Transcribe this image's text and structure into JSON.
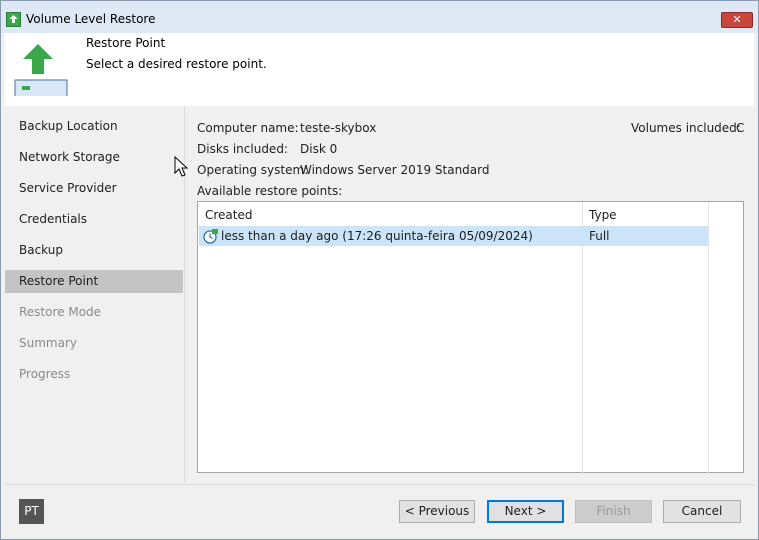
{
  "window": {
    "title": "Volume Level Restore",
    "close_label": "✕"
  },
  "header": {
    "title": "Restore Point",
    "subtitle": "Select a desired restore point."
  },
  "sidebar": {
    "items": [
      {
        "label": "Backup Location",
        "state": "normal"
      },
      {
        "label": "Network Storage",
        "state": "normal"
      },
      {
        "label": "Service Provider",
        "state": "normal"
      },
      {
        "label": "Credentials",
        "state": "normal"
      },
      {
        "label": "Backup",
        "state": "normal"
      },
      {
        "label": "Restore Point",
        "state": "active"
      },
      {
        "label": "Restore Mode",
        "state": "disabled"
      },
      {
        "label": "Summary",
        "state": "disabled"
      },
      {
        "label": "Progress",
        "state": "disabled"
      }
    ]
  },
  "details": {
    "computer_label": "Computer name:",
    "computer_value": "teste-skybox",
    "disks_label": "Disks included:",
    "disks_value": "Disk 0",
    "os_label": "Operating system:",
    "os_value": "Windows Server 2019 Standard",
    "volumes_label": "Volumes included:",
    "volumes_value": "C",
    "available_label": "Available restore points:"
  },
  "restore_points": {
    "columns": [
      "Created",
      "Type"
    ],
    "rows": [
      {
        "created": "less than a day ago (17:26 quinta-feira 05/09/2024)",
        "type": "Full",
        "selected": true
      }
    ]
  },
  "footer": {
    "badge": "PT",
    "previous": "< Previous",
    "next": "Next >",
    "finish": "Finish",
    "cancel": "Cancel"
  },
  "colors": {
    "accent": "#0078d7",
    "selection": "#cce4f7",
    "active_step": "#c4c4c4",
    "veeam_green": "#3aa84a"
  }
}
